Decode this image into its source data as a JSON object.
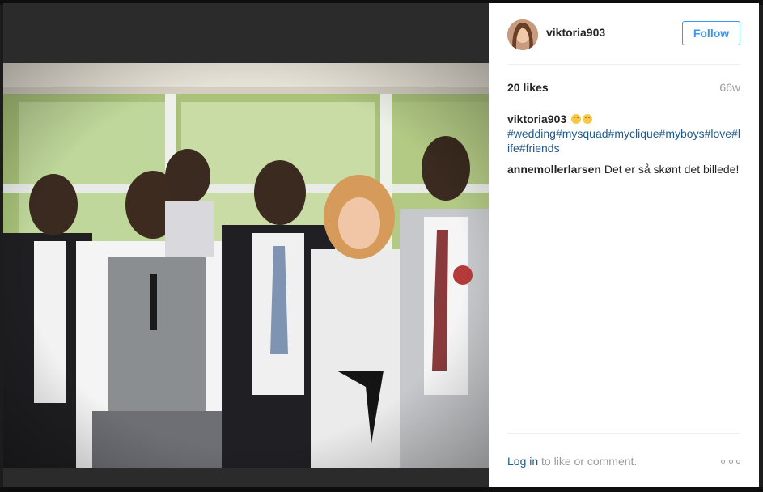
{
  "post": {
    "author": {
      "username": "viktoria903",
      "avatar_icon": "profile-avatar"
    },
    "follow_label": "Follow",
    "likes": "20 likes",
    "age": "66w",
    "photo_icon": "group-wedding-photo",
    "caption": {
      "username": "viktoria903",
      "emoji_icon": "heart-eyes-emoji",
      "hashtags": "#wedding#mysquad#myclique#myboys#love#life#friends"
    },
    "comments": [
      {
        "username": "annemollerlarsen",
        "text": "Det er så skønt det billede!"
      }
    ],
    "footer": {
      "login_link": "Log in",
      "login_suffix": " to like or comment."
    }
  },
  "colors": {
    "accent": "#3897f0",
    "link": "#1e5a8c",
    "muted": "#999999",
    "text": "#262626"
  }
}
